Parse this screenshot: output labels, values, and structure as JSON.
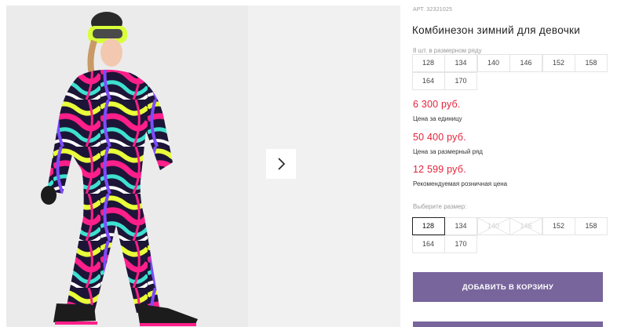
{
  "product": {
    "article": "АРТ. 32321025",
    "title": "Комбинезон зимний для девочки",
    "image_description": "Girl in winter jumpsuit with swirl print"
  },
  "pack": {
    "label": "8 шт. в размерном ряду",
    "sizes": [
      "128",
      "134",
      "140",
      "146",
      "152",
      "158",
      "164",
      "170"
    ]
  },
  "prices": [
    {
      "value": "6 300 руб.",
      "caption": "Цена за единицу"
    },
    {
      "value": "50 400 руб.",
      "caption": "Цена за размерный ряд"
    },
    {
      "value": "12 599 руб.",
      "caption": "Рекомендуемая розничная цена"
    }
  ],
  "size_select": {
    "label": "Выберите размер:",
    "selected": "128",
    "options": [
      {
        "label": "128",
        "state": "selected"
      },
      {
        "label": "134",
        "state": "available"
      },
      {
        "label": "140",
        "state": "unavailable"
      },
      {
        "label": "146",
        "state": "unavailable"
      },
      {
        "label": "152",
        "state": "available"
      },
      {
        "label": "158",
        "state": "available"
      },
      {
        "label": "164",
        "state": "available"
      },
      {
        "label": "170",
        "state": "available"
      }
    ]
  },
  "buttons": {
    "add_to_cart": "ДОБАВИТЬ В КОРЗИНУ",
    "next_icon": "chevron-right-icon"
  },
  "colors": {
    "accent": "#78659c",
    "price": "#e3243b",
    "border": "#e5e5e5"
  }
}
